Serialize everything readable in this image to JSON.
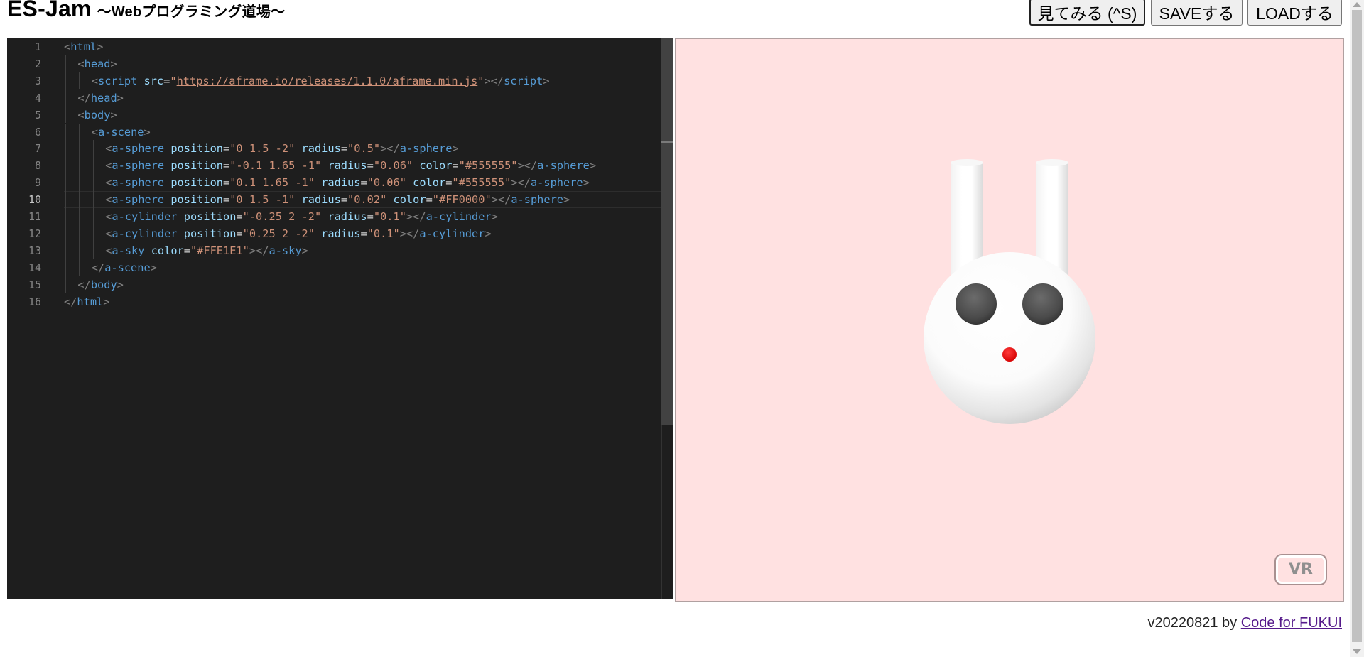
{
  "header": {
    "title": "ES-Jam",
    "subtitle": "～Webプログラミング道場～",
    "buttons": {
      "run": "見てみる (^S)",
      "save": "SAVEする",
      "load": "LOADする"
    }
  },
  "editor": {
    "active_line": 10,
    "lines": [
      {
        "num": "1",
        "indent": 0,
        "tokens": [
          [
            "p",
            "<"
          ],
          [
            "t",
            "html"
          ],
          [
            "p",
            ">"
          ]
        ]
      },
      {
        "num": "2",
        "indent": 1,
        "tokens": [
          [
            "p",
            "<"
          ],
          [
            "t",
            "head"
          ],
          [
            "p",
            ">"
          ]
        ]
      },
      {
        "num": "3",
        "indent": 2,
        "tokens": [
          [
            "p",
            "<"
          ],
          [
            "t",
            "script"
          ],
          [
            "e",
            " "
          ],
          [
            "a",
            "src"
          ],
          [
            "e",
            "="
          ],
          [
            "s",
            "\""
          ],
          [
            "l",
            "https://aframe.io/releases/1.1.0/aframe.min.js"
          ],
          [
            "s",
            "\""
          ],
          [
            "p",
            "></"
          ],
          [
            "t",
            "script"
          ],
          [
            "p",
            ">"
          ]
        ]
      },
      {
        "num": "4",
        "indent": 1,
        "tokens": [
          [
            "p",
            "</"
          ],
          [
            "t",
            "head"
          ],
          [
            "p",
            ">"
          ]
        ]
      },
      {
        "num": "5",
        "indent": 1,
        "tokens": [
          [
            "p",
            "<"
          ],
          [
            "t",
            "body"
          ],
          [
            "p",
            ">"
          ]
        ]
      },
      {
        "num": "6",
        "indent": 2,
        "tokens": [
          [
            "p",
            "<"
          ],
          [
            "t",
            "a-scene"
          ],
          [
            "p",
            ">"
          ]
        ]
      },
      {
        "num": "7",
        "indent": 3,
        "tokens": [
          [
            "p",
            "<"
          ],
          [
            "t",
            "a-sphere"
          ],
          [
            "e",
            " "
          ],
          [
            "a",
            "position"
          ],
          [
            "e",
            "="
          ],
          [
            "s",
            "\"0 1.5 -2\""
          ],
          [
            "e",
            " "
          ],
          [
            "a",
            "radius"
          ],
          [
            "e",
            "="
          ],
          [
            "s",
            "\"0.5\""
          ],
          [
            "p",
            "></"
          ],
          [
            "t",
            "a-sphere"
          ],
          [
            "p",
            ">"
          ]
        ]
      },
      {
        "num": "8",
        "indent": 3,
        "tokens": [
          [
            "p",
            "<"
          ],
          [
            "t",
            "a-sphere"
          ],
          [
            "e",
            " "
          ],
          [
            "a",
            "position"
          ],
          [
            "e",
            "="
          ],
          [
            "s",
            "\"-0.1 1.65 -1\""
          ],
          [
            "e",
            " "
          ],
          [
            "a",
            "radius"
          ],
          [
            "e",
            "="
          ],
          [
            "s",
            "\"0.06\""
          ],
          [
            "e",
            " "
          ],
          [
            "a",
            "color"
          ],
          [
            "e",
            "="
          ],
          [
            "s",
            "\"#555555\""
          ],
          [
            "p",
            "></"
          ],
          [
            "t",
            "a-sphere"
          ],
          [
            "p",
            ">"
          ]
        ]
      },
      {
        "num": "9",
        "indent": 3,
        "tokens": [
          [
            "p",
            "<"
          ],
          [
            "t",
            "a-sphere"
          ],
          [
            "e",
            " "
          ],
          [
            "a",
            "position"
          ],
          [
            "e",
            "="
          ],
          [
            "s",
            "\"0.1 1.65 -1\""
          ],
          [
            "e",
            " "
          ],
          [
            "a",
            "radius"
          ],
          [
            "e",
            "="
          ],
          [
            "s",
            "\"0.06\""
          ],
          [
            "e",
            " "
          ],
          [
            "a",
            "color"
          ],
          [
            "e",
            "="
          ],
          [
            "s",
            "\"#555555\""
          ],
          [
            "p",
            "></"
          ],
          [
            "t",
            "a-sphere"
          ],
          [
            "p",
            ">"
          ]
        ]
      },
      {
        "num": "10",
        "indent": 3,
        "tokens": [
          [
            "p",
            "<"
          ],
          [
            "t",
            "a-sphere"
          ],
          [
            "e",
            " "
          ],
          [
            "a",
            "position"
          ],
          [
            "e",
            "="
          ],
          [
            "s",
            "\"0 1.5 -1\""
          ],
          [
            "e",
            " "
          ],
          [
            "a",
            "radius"
          ],
          [
            "e",
            "="
          ],
          [
            "s",
            "\"0.02\""
          ],
          [
            "e",
            " "
          ],
          [
            "a",
            "color"
          ],
          [
            "e",
            "="
          ],
          [
            "s",
            "\"#FF0000\""
          ],
          [
            "p",
            "></"
          ],
          [
            "t",
            "a-sphere"
          ],
          [
            "p",
            ">"
          ]
        ]
      },
      {
        "num": "11",
        "indent": 3,
        "tokens": [
          [
            "p",
            "<"
          ],
          [
            "t",
            "a-cylinder"
          ],
          [
            "e",
            " "
          ],
          [
            "a",
            "position"
          ],
          [
            "e",
            "="
          ],
          [
            "s",
            "\"-0.25 2 -2\""
          ],
          [
            "e",
            " "
          ],
          [
            "a",
            "radius"
          ],
          [
            "e",
            "="
          ],
          [
            "s",
            "\"0.1\""
          ],
          [
            "p",
            "></"
          ],
          [
            "t",
            "a-cylinder"
          ],
          [
            "p",
            ">"
          ]
        ]
      },
      {
        "num": "12",
        "indent": 3,
        "tokens": [
          [
            "p",
            "<"
          ],
          [
            "t",
            "a-cylinder"
          ],
          [
            "e",
            " "
          ],
          [
            "a",
            "position"
          ],
          [
            "e",
            "="
          ],
          [
            "s",
            "\"0.25 2 -2\""
          ],
          [
            "e",
            " "
          ],
          [
            "a",
            "radius"
          ],
          [
            "e",
            "="
          ],
          [
            "s",
            "\"0.1\""
          ],
          [
            "p",
            "></"
          ],
          [
            "t",
            "a-cylinder"
          ],
          [
            "p",
            ">"
          ]
        ]
      },
      {
        "num": "13",
        "indent": 3,
        "tokens": [
          [
            "p",
            "<"
          ],
          [
            "t",
            "a-sky"
          ],
          [
            "e",
            " "
          ],
          [
            "a",
            "color"
          ],
          [
            "e",
            "="
          ],
          [
            "s",
            "\"#FFE1E1\""
          ],
          [
            "p",
            "></"
          ],
          [
            "t",
            "a-sky"
          ],
          [
            "p",
            ">"
          ]
        ]
      },
      {
        "num": "14",
        "indent": 2,
        "tokens": [
          [
            "p",
            "</"
          ],
          [
            "t",
            "a-scene"
          ],
          [
            "p",
            ">"
          ]
        ]
      },
      {
        "num": "15",
        "indent": 1,
        "tokens": [
          [
            "p",
            "</"
          ],
          [
            "t",
            "body"
          ],
          [
            "p",
            ">"
          ]
        ]
      },
      {
        "num": "16",
        "indent": 0,
        "tokens": [
          [
            "p",
            "</"
          ],
          [
            "t",
            "html"
          ],
          [
            "p",
            ">"
          ]
        ]
      }
    ]
  },
  "preview": {
    "sky_color": "#FFE1E1",
    "eye_color": "#555555",
    "nose_color": "#FF0000",
    "vr_label": "VR"
  },
  "footer": {
    "version": "v20220821 by ",
    "link_text": "Code for FUKUI"
  }
}
